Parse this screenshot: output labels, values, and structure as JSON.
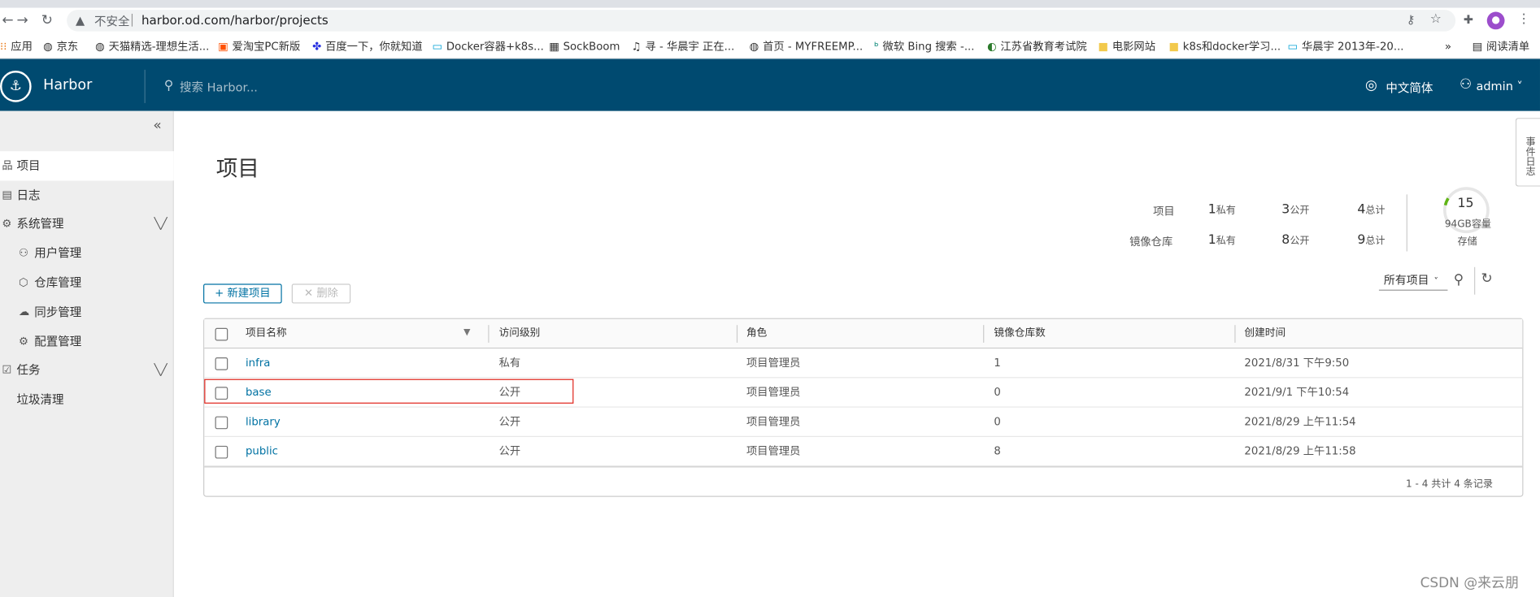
{
  "browser": {
    "security": "不安全",
    "url": "harbor.od.com/harbor/projects",
    "bookmarks": [
      {
        "icon": "apps-icon",
        "label": "应用"
      },
      {
        "icon": "globe-icon",
        "label": "京东"
      },
      {
        "icon": "globe-icon",
        "label": "天猫精选-理想生活..."
      },
      {
        "icon": "taobao-icon",
        "label": "爱淘宝PC新版"
      },
      {
        "icon": "baidu-icon",
        "label": "百度一下，你就知道"
      },
      {
        "icon": "bilibili-icon",
        "label": "Docker容器+k8s..."
      },
      {
        "icon": "sockboom-icon",
        "label": "SockBoom"
      },
      {
        "icon": "music-icon",
        "label": "寻 - 华晨宇 正在..."
      },
      {
        "icon": "globe-icon",
        "label": "首页 - MYFREEMP..."
      },
      {
        "icon": "bing-icon",
        "label": "微软 Bing 搜索 -..."
      },
      {
        "icon": "edu-icon",
        "label": "江苏省教育考试院"
      },
      {
        "icon": "folder-icon",
        "label": "电影网站"
      },
      {
        "icon": "folder-icon",
        "label": "k8s和docker学习..."
      },
      {
        "icon": "bilibili-icon",
        "label": "华晨宇 2013年-20..."
      }
    ],
    "more_bookmarks": "»",
    "reading_list": "阅读清单"
  },
  "header": {
    "brand": "Harbor",
    "search_placeholder": "搜索 Harbor...",
    "language": "中文简体",
    "user": "admin"
  },
  "sidebar": {
    "items": [
      {
        "label": "项目",
        "icon": "project-icon",
        "active": true
      },
      {
        "label": "日志",
        "icon": "log-icon"
      },
      {
        "label": "系统管理",
        "icon": "admin-icon",
        "expandable": true
      },
      {
        "label": "用户管理",
        "icon": "users-icon",
        "sub": true
      },
      {
        "label": "仓库管理",
        "icon": "registry-icon",
        "sub": true
      },
      {
        "label": "同步管理",
        "icon": "replication-icon",
        "sub": true
      },
      {
        "label": "配置管理",
        "icon": "config-icon",
        "sub": true
      },
      {
        "label": "任务",
        "icon": "task-icon",
        "expandable": true
      },
      {
        "label": "垃圾清理",
        "sub": true
      }
    ]
  },
  "page": {
    "title": "项目",
    "stats": {
      "projects_label": "项目",
      "repos_label": "镜像仓库",
      "projects": {
        "private": "1",
        "public": "3",
        "total": "4"
      },
      "repos": {
        "private": "1",
        "public": "8",
        "total": "9"
      },
      "private_label": "私有",
      "public_label": "公开",
      "total_label": "总计",
      "storage_value": "15",
      "storage_capacity": "94GB容量",
      "storage_label": "存储"
    },
    "new_project": "新建项目",
    "delete": "删除",
    "filter_label": "所有项目"
  },
  "table": {
    "headers": [
      "项目名称",
      "访问级别",
      "角色",
      "镜像仓库数",
      "创建时间"
    ],
    "rows": [
      {
        "name": "infra",
        "access": "私有",
        "role": "项目管理员",
        "repos": "1",
        "created": "2021/8/31 下午9:50"
      },
      {
        "name": "base",
        "access": "公开",
        "role": "项目管理员",
        "repos": "0",
        "created": "2021/9/1 下午10:54"
      },
      {
        "name": "library",
        "access": "公开",
        "role": "项目管理员",
        "repos": "0",
        "created": "2021/8/29 上午11:54"
      },
      {
        "name": "public",
        "access": "公开",
        "role": "项目管理员",
        "repos": "8",
        "created": "2021/8/29 上午11:58"
      }
    ],
    "footer": "1 - 4 共计 4 条记录"
  },
  "side_flag": "事件日志",
  "watermark": "CSDN @来云朋",
  "colors": {
    "header": "#004a70",
    "link": "#0072a3",
    "highlight": "#e0241b"
  }
}
